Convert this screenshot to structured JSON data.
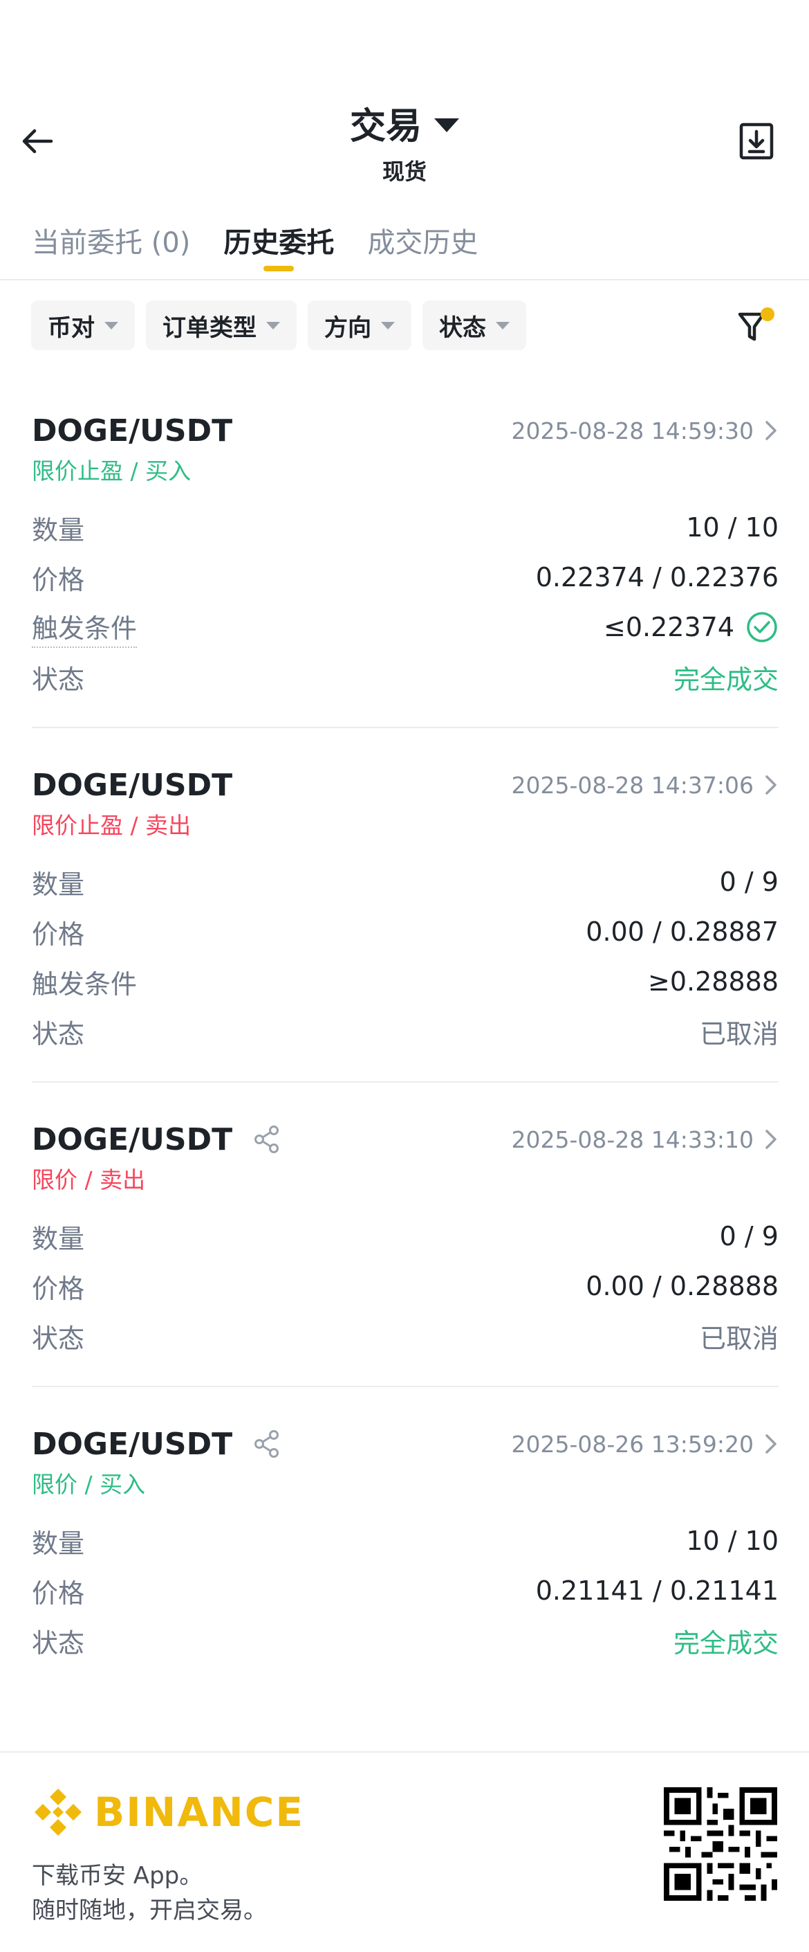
{
  "header": {
    "title": "交易",
    "subtitle": "现货"
  },
  "tabs": [
    {
      "label": "当前委托 (0)",
      "active": false
    },
    {
      "label": "历史委托",
      "active": true
    },
    {
      "label": "成交历史",
      "active": false
    }
  ],
  "filters": [
    {
      "label": "币对"
    },
    {
      "label": "订单类型"
    },
    {
      "label": "方向"
    },
    {
      "label": "状态"
    }
  ],
  "colors": {
    "accent": "#f0b90b",
    "buy": "#2ebd85",
    "sell": "#f6465d",
    "muted": "#848e9c"
  },
  "orders": [
    {
      "pair": "DOGE/USDT",
      "time": "2025-08-28 14:59:30",
      "type": "限价止盈 / 买入",
      "side": "buy",
      "qty_label": "数量",
      "qty": "10 / 10",
      "price_label": "价格",
      "price": "0.22374 / 0.22376",
      "trigger_label": "触发条件",
      "trigger": "≤0.22374",
      "status_label": "状态",
      "status": "完全成交"
    },
    {
      "pair": "DOGE/USDT",
      "time": "2025-08-28 14:37:06",
      "type": "限价止盈 / 卖出",
      "side": "sell",
      "qty_label": "数量",
      "qty": "0 / 9",
      "price_label": "价格",
      "price": "0.00 / 0.28887",
      "trigger_label": "触发条件",
      "trigger": "≥0.28888",
      "status_label": "状态",
      "status": "已取消"
    },
    {
      "pair": "DOGE/USDT",
      "time": "2025-08-28 14:33:10",
      "type": "限价 / 卖出",
      "side": "sell",
      "qty_label": "数量",
      "qty": "0 / 9",
      "price_label": "价格",
      "price": "0.00 / 0.28888",
      "status_label": "状态",
      "status": "已取消"
    },
    {
      "pair": "DOGE/USDT",
      "time": "2025-08-26 13:59:20",
      "type": "限价 / 买入",
      "side": "buy",
      "qty_label": "数量",
      "qty": "10 / 10",
      "price_label": "价格",
      "price": "0.21141 / 0.21141",
      "status_label": "状态",
      "status": "完全成交"
    }
  ],
  "footer": {
    "brand": "BINANCE",
    "line1": "下载币安 App。",
    "line2": "随时随地，开启交易。"
  }
}
